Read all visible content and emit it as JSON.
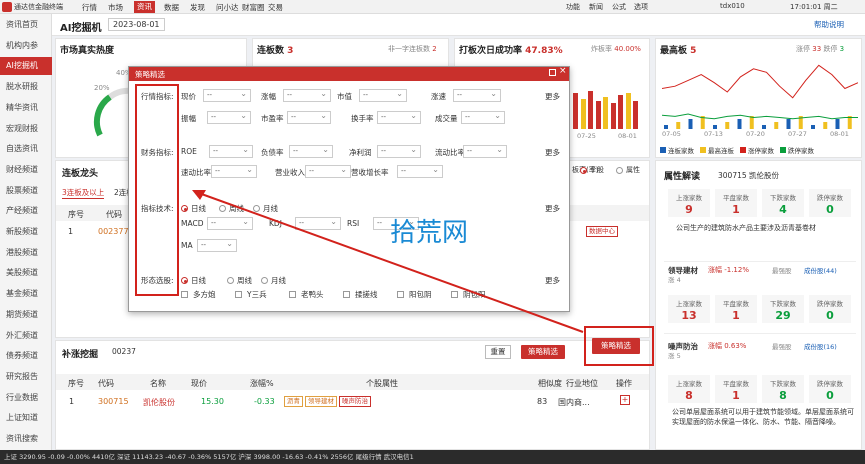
{
  "app": {
    "title": "通达信金融终端",
    "menus": [
      "行情",
      "市场",
      "资讯",
      "数据",
      "发现",
      "问小达",
      "财富圈",
      "交易"
    ],
    "active_menu": "资讯",
    "right_menus": [
      "功能",
      "新闻",
      "公式",
      "选项"
    ],
    "account": "tdx010",
    "clock": "17:01:01 周二"
  },
  "nav": [
    "资讯首页",
    "机构内参",
    "AI挖掘机",
    "脱水研报",
    "精华资讯",
    "宏观财报",
    "自选资讯",
    "财经频道",
    "股票频道",
    "产经频道",
    "新股频道",
    "港股频道",
    "美股频道",
    "基金频道",
    "期货频道",
    "外汇频道",
    "债券频道",
    "研究报告",
    "行业数据",
    "上证知道",
    "资讯搜索"
  ],
  "nav_active_index": 2,
  "header": {
    "title": "AI挖掘机",
    "date": "2023-08-01",
    "help": "帮助说明"
  },
  "heat": {
    "title": "市场真实热度",
    "pct_low": "20%",
    "pct_mid": "40%",
    "value": "4"
  },
  "streak": {
    "title": "连板数",
    "count": "3",
    "sub_label": "非一字连板数",
    "sub_count": "2"
  },
  "success": {
    "title": "打板次日成功率",
    "rate": "47.83%",
    "sub_label": "炸板率",
    "sub_rate": "40.00%",
    "x_labels": [
      "07-25",
      "08-01"
    ],
    "bars": [
      0.9,
      0.75,
      0.95,
      0.7,
      0.8,
      0.65,
      0.85,
      0.9,
      0.7
    ]
  },
  "highest": {
    "title": "最高板",
    "value": "5",
    "up_label": "涨停",
    "up": "33",
    "down_label": "跌停",
    "down": "3",
    "x_labels": [
      "07-05",
      "07-13",
      "07-20",
      "07-27",
      "08-01"
    ],
    "line_up": [
      28,
      30,
      35,
      40,
      33,
      25,
      38,
      45,
      42,
      30,
      20,
      35,
      48,
      40,
      28,
      33
    ],
    "line_down": [
      5,
      4,
      6,
      3,
      2,
      4,
      5,
      3,
      4,
      3,
      2,
      3,
      4,
      2,
      3,
      3
    ],
    "legend": [
      "连板家数",
      "最高连板",
      "涨停家数",
      "跌停家数"
    ]
  },
  "lianban": {
    "title": "连板龙头",
    "tabs": [
      "3连板及以上",
      "2连板"
    ],
    "cols": [
      "序号",
      "代码"
    ],
    "row": {
      "idx": "1",
      "code": "002377"
    },
    "chk": "只看...",
    "opt1": "个股",
    "opt2": "属性",
    "badge": "数据中心",
    "partial": "板率(率)"
  },
  "attr": {
    "title": "属性解读",
    "stock": "300715 凯伦股份",
    "stats1": [
      {
        "t": "上涨家数",
        "v": "9",
        "c": "red"
      },
      {
        "t": "平盘家数",
        "v": "1",
        "c": "red"
      },
      {
        "t": "下跌家数",
        "v": "4",
        "c": "green"
      },
      {
        "t": "跌停家数",
        "v": "0",
        "c": "green"
      }
    ],
    "desc": "公司生产的建筑防水产品主要涉及沥青基卷材",
    "sec1": {
      "name": "领导建材",
      "tag": "涨 4",
      "pct": "涨幅 -1.12%",
      "rank": "最强股",
      "n": "成份股(44)"
    },
    "stats2": [
      {
        "t": "上涨家数",
        "v": "13",
        "c": "red"
      },
      {
        "t": "平盘家数",
        "v": "1",
        "c": "red"
      },
      {
        "t": "下跌家数",
        "v": "29",
        "c": "green"
      },
      {
        "t": "跌停家数",
        "v": "0",
        "c": "green"
      }
    ],
    "sec2": {
      "name": "噪声防治",
      "tag": "涨 5",
      "pct": "涨幅 0.63%",
      "rank": "最强股",
      "n": "成份股(16)"
    },
    "stats3": [
      {
        "t": "上涨家数",
        "v": "8",
        "c": "red"
      },
      {
        "t": "平盘家数",
        "v": "1",
        "c": "red"
      },
      {
        "t": "下跌家数",
        "v": "8",
        "c": "green"
      },
      {
        "t": "跌停家数",
        "v": "0",
        "c": "green"
      }
    ],
    "desc2": "公司单层屋面系统可以用于建筑节能领域。单层屋面系统可实现屋面的防水保温一体化、防水、节能、隔音降噪。"
  },
  "dialog": {
    "title": "策略精选",
    "row1_label": "行情指标:",
    "row1": [
      "现价",
      "涨幅",
      "市值",
      "涨速",
      "量比"
    ],
    "row1b": [
      "振幅",
      "市盈率",
      "换手率",
      "成交量"
    ],
    "row2_label": "财务指标:",
    "row2": [
      "ROE",
      "负债率",
      "净利润",
      "流动比率"
    ],
    "row2b": [
      "速动比率",
      "营业收入",
      "营收增长率"
    ],
    "row3_label": "指标技术:",
    "periods": [
      "日线",
      "周线",
      "月线"
    ],
    "row3": [
      "MACD",
      "KDJ",
      "RSI",
      "MA"
    ],
    "row4_label": "形态选股:",
    "patterns": [
      "多方炮",
      "Y三兵",
      "老鸭头",
      "揉搓线",
      "阳包阴",
      "阴包阳"
    ],
    "more": "更多",
    "dash": "--"
  },
  "watermark": "拾荒网",
  "supp": {
    "title": "补涨挖掘",
    "code": "00237",
    "reset": "重置",
    "strategy": "策略精选",
    "cols": [
      "序号",
      "代码",
      "名称",
      "现价",
      "涨幅%",
      "个股属性",
      "相似度",
      "行业地位",
      "操作"
    ],
    "row": {
      "idx": "1",
      "code": "300715",
      "name": "凯伦股份",
      "price": "15.30",
      "chg": "-0.33",
      "tags": [
        "沥青",
        "领导建材",
        "噪声防治"
      ],
      "sim": "83",
      "pos": "国内商..."
    }
  },
  "strategy_btn": "策略精选",
  "status": "上证 3290.95  -0.09  -0.00%  4410亿   深证 11143.23  -40.67  -0.36%  5157亿   沪深 3998.00  -16.63  -0.41%  2556亿      尾级行情  武汉电信1"
}
